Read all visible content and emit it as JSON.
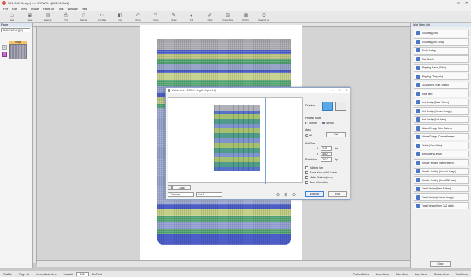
{
  "window": {
    "title": "SDS-ONE Design | 4.0 (WWWW) - [BODY1 Cut1]"
  },
  "menu": [
    "File",
    "Edit",
    "View",
    "Image",
    "Paste-up",
    "Tool",
    "Window",
    "Help"
  ],
  "toolbar": [
    {
      "label": "New",
      "icon": "new-file-icon"
    },
    {
      "label": "Save",
      "icon": "save-icon"
    },
    {
      "label": "Scanner",
      "icon": "scanner-icon"
    },
    {
      "label": "Print",
      "icon": "print-icon"
    },
    {
      "label": "Manual",
      "icon": "manual-icon"
    },
    {
      "label": "Cut Data",
      "icon": "cut-data-icon"
    },
    {
      "label": "Fore",
      "icon": "fore-icon"
    },
    {
      "label": "Undo",
      "icon": "undo-icon"
    },
    {
      "label": "Redo",
      "icon": "redo-icon"
    },
    {
      "label": "Draw",
      "icon": "draw-icon"
    },
    {
      "label": "Fill",
      "icon": "fill-icon"
    },
    {
      "label": "Paint",
      "icon": "paint-icon"
    },
    {
      "label": "Image Size",
      "icon": "image-size-icon"
    },
    {
      "label": "Knitting",
      "icon": "knitting-icon"
    },
    {
      "label": "Material Ed",
      "icon": "material-editor-icon"
    }
  ],
  "layer_panel": {
    "header": "Page",
    "document": "BODY1 Cut1(Q2)",
    "layer_label": "Image"
  },
  "right_panel": {
    "header": "Work Menu List",
    "items": [
      "Colorway (Grid)",
      "Colorway (Full Color)",
      "Photo Collage",
      "Flat Sketch",
      "Mapping (Mesh_Editor)",
      "Mapping (Template)",
      "3D Mapping (Knit Design)",
      "Input Yarn",
      "Knit Design (New Pattern)",
      "Knit Design (Convert Image)",
      "Knit Design (Knit Paint)",
      "Weave Design (New Pattern)",
      "Weave Design (Convert Image)",
      "Textile (Yarn Order)",
      "Embroidery Design",
      "Circular Knitting (New Pattern)",
      "Circular Knitting (Convert Image)",
      "Circular Knitting (from CAD data)",
      "Towel Design (New Pattern)",
      "Towel Design (Convert Image)",
      "Towel Design (from CAD data)"
    ],
    "close_label": "Close"
  },
  "dialog": {
    "title": "Virtual Knit - BODY1 (Light Upper-left)",
    "load_label": "Load",
    "colorway_select": "Colorway",
    "col_select": "Col 1",
    "direction_label": "Direction",
    "process_mode_label": "Process Mode",
    "mode_simple": "Simple",
    "mode_normal": "Normal",
    "area_label": "Area",
    "area_all": "All",
    "area_set": "Set",
    "knit_size_label": "Knit Size",
    "x_label": "X",
    "x_value": "1198",
    "x_unit": "dot",
    "y_label": "Y",
    "y_value": "1650",
    "resolution_label": "Resolution",
    "resolution_value": "200.0",
    "resolution_unit": "dpi",
    "check_knitting_yarn": "Knitting Yarn",
    "check_same_yarn": "Same Yarn for All Carries",
    "check_make_shadow": "Make Shadow (Auto)",
    "check_save_info": "Save information",
    "execute_label": "Execute",
    "end_label": "End"
  },
  "statusbar": {
    "items": [
      "Tool Box",
      "Page List",
      "Conventional Menu",
      "Tracksell",
      "Cur Point"
    ],
    "zoom": "236",
    "right_items": [
      "Position & View",
      "Zoom Menu",
      "Color Menu",
      "Layer Menu",
      "Custom Menu",
      "Work Menu"
    ]
  }
}
